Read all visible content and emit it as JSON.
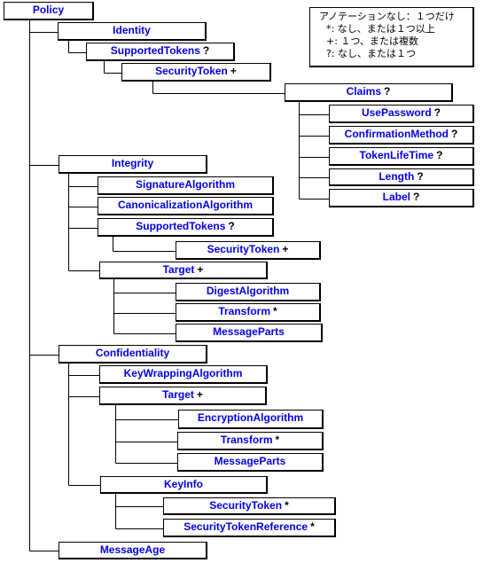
{
  "diagram": {
    "type": "tree",
    "nodes": [
      {
        "id": "policy",
        "label": "Policy",
        "card": ""
      },
      {
        "id": "identity",
        "label": "Identity",
        "card": ""
      },
      {
        "id": "id-supported-tokens",
        "label": "SupportedTokens",
        "card": "?"
      },
      {
        "id": "id-security-token",
        "label": "SecurityToken",
        "card": "+"
      },
      {
        "id": "claims",
        "label": "Claims",
        "card": "?"
      },
      {
        "id": "use-password",
        "label": "UsePassword",
        "card": "?"
      },
      {
        "id": "confirmation-method",
        "label": "ConfirmationMethod",
        "card": "?"
      },
      {
        "id": "token-lifetime",
        "label": "TokenLifeTime",
        "card": "?"
      },
      {
        "id": "length",
        "label": "Length",
        "card": "?"
      },
      {
        "id": "label",
        "label": "Label",
        "card": "?"
      },
      {
        "id": "integrity",
        "label": "Integrity",
        "card": ""
      },
      {
        "id": "signature-algorithm",
        "label": "SignatureAlgorithm",
        "card": ""
      },
      {
        "id": "canonicalization-algorithm",
        "label": "CanonicalizationAlgorithm",
        "card": ""
      },
      {
        "id": "int-supported-tokens",
        "label": "SupportedTokens",
        "card": "?"
      },
      {
        "id": "int-security-token",
        "label": "SecurityToken",
        "card": "+"
      },
      {
        "id": "int-target",
        "label": "Target",
        "card": "+"
      },
      {
        "id": "digest-algorithm",
        "label": "DigestAlgorithm",
        "card": ""
      },
      {
        "id": "int-transform",
        "label": "Transform",
        "card": "*"
      },
      {
        "id": "int-message-parts",
        "label": "MessageParts",
        "card": ""
      },
      {
        "id": "confidentiality",
        "label": "Confidentiality",
        "card": ""
      },
      {
        "id": "key-wrapping-algorithm",
        "label": "KeyWrappingAlgorithm",
        "card": ""
      },
      {
        "id": "conf-target",
        "label": "Target",
        "card": "+"
      },
      {
        "id": "encryption-algorithm",
        "label": "EncryptionAlgorithm",
        "card": ""
      },
      {
        "id": "conf-transform",
        "label": "Transform",
        "card": "*"
      },
      {
        "id": "conf-message-parts",
        "label": "MessageParts",
        "card": ""
      },
      {
        "id": "key-info",
        "label": "KeyInfo",
        "card": ""
      },
      {
        "id": "ki-security-token",
        "label": "SecurityToken",
        "card": "*"
      },
      {
        "id": "security-token-reference",
        "label": "SecurityTokenReference",
        "card": "*"
      },
      {
        "id": "message-age",
        "label": "MessageAge",
        "card": ""
      }
    ],
    "edges": [
      [
        "policy",
        "identity"
      ],
      [
        "identity",
        "id-supported-tokens"
      ],
      [
        "id-supported-tokens",
        "id-security-token"
      ],
      [
        "id-security-token",
        "claims"
      ],
      [
        "claims",
        "use-password"
      ],
      [
        "claims",
        "confirmation-method"
      ],
      [
        "claims",
        "token-lifetime"
      ],
      [
        "claims",
        "length"
      ],
      [
        "claims",
        "label"
      ],
      [
        "policy",
        "integrity"
      ],
      [
        "integrity",
        "signature-algorithm"
      ],
      [
        "integrity",
        "canonicalization-algorithm"
      ],
      [
        "integrity",
        "int-supported-tokens"
      ],
      [
        "int-supported-tokens",
        "int-security-token"
      ],
      [
        "integrity",
        "int-target"
      ],
      [
        "int-target",
        "digest-algorithm"
      ],
      [
        "int-target",
        "int-transform"
      ],
      [
        "int-target",
        "int-message-parts"
      ],
      [
        "policy",
        "confidentiality"
      ],
      [
        "confidentiality",
        "key-wrapping-algorithm"
      ],
      [
        "confidentiality",
        "conf-target"
      ],
      [
        "conf-target",
        "encryption-algorithm"
      ],
      [
        "conf-target",
        "conf-transform"
      ],
      [
        "conf-target",
        "conf-message-parts"
      ],
      [
        "confidentiality",
        "key-info"
      ],
      [
        "key-info",
        "ki-security-token"
      ],
      [
        "key-info",
        "security-token-reference"
      ],
      [
        "policy",
        "message-age"
      ]
    ]
  },
  "legend": {
    "rows": [
      "アノテーションなし：１つだけ",
      "*: なし、または１つ以上",
      "+: １つ、または複数",
      "?: なし、または１つ"
    ]
  },
  "colors": {
    "element_text": "#0000e6",
    "cardinality_text": "#000000",
    "border": "#000000",
    "background": "#ffffff"
  }
}
